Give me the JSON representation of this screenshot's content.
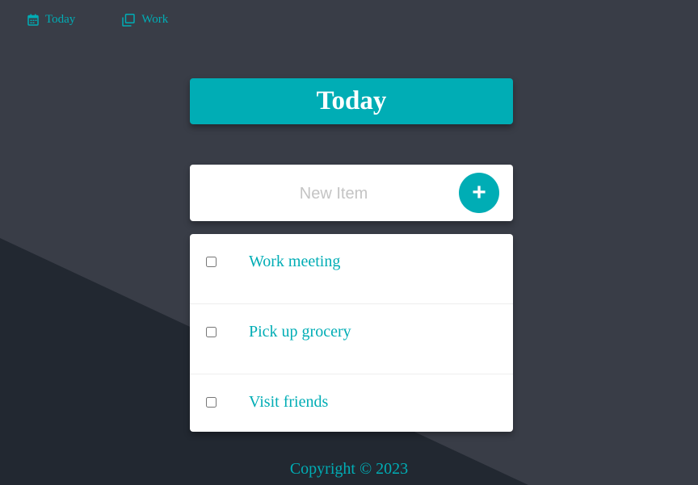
{
  "nav": {
    "items": [
      {
        "label": "Today",
        "icon": "calendar-icon"
      },
      {
        "label": "Work",
        "icon": "copy-icon"
      }
    ]
  },
  "heading": {
    "title": "Today"
  },
  "new_item": {
    "placeholder": "New Item",
    "value": "",
    "add_label": "+"
  },
  "list": {
    "items": [
      {
        "label": "Work meeting",
        "checked": false
      },
      {
        "label": "Pick up grocery",
        "checked": false
      },
      {
        "label": "Visit friends",
        "checked": false
      }
    ]
  },
  "footer": {
    "copyright": "Copyright © 2023"
  },
  "colors": {
    "accent": "#00adb5",
    "background": "#393d47",
    "background_dark": "#222831",
    "card": "#ffffff"
  }
}
